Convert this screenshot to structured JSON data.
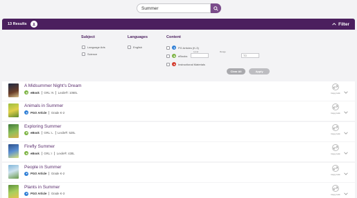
{
  "search": {
    "value": "Summer"
  },
  "results_bar": {
    "count_label": "13 Results",
    "filter_label": "Filter"
  },
  "filters": {
    "subject": {
      "title": "Subject",
      "options": [
        "Language Arts",
        "Science"
      ]
    },
    "languages": {
      "title": "Languages",
      "options": [
        "English"
      ]
    },
    "content": {
      "title": "Content",
      "options": [
        "PG Articles (K-3)",
        "eBooks",
        "Instructional Materials"
      ],
      "range_label_left": "Level",
      "range_label_right": "Range",
      "range_from": "",
      "range_to": "TO"
    },
    "clear_all": "Clear All",
    "apply": "Apply"
  },
  "results": [
    {
      "title": "A Midsummer Night's Dream",
      "type": "eBook",
      "meta1": "GRL: N",
      "meta2": "Lexile®: 1060L",
      "copy": "Copy Link"
    },
    {
      "title": "Animals in Summer",
      "type": "PGO Article",
      "meta1": "Grade K-2",
      "meta2": "",
      "copy": "Copy Link"
    },
    {
      "title": "Exploring Summer",
      "type": "eBook",
      "meta1": "GRL: L",
      "meta2": "Lexile®: 520L",
      "copy": "Copy Link"
    },
    {
      "title": "Firefly Summer",
      "type": "eBook",
      "meta1": "GRL: I",
      "meta2": "Lexile®: 430L",
      "copy": "Copy Link"
    },
    {
      "title": "People in Summer",
      "type": "PGO Article",
      "meta1": "Grade K-2",
      "meta2": "",
      "copy": "Copy Link"
    },
    {
      "title": "Plants in Summer",
      "type": "PGO Article",
      "meta1": "Grade K-3",
      "meta2": "",
      "copy": "Copy Link"
    }
  ],
  "colors": {
    "brand_purple": "#4b1f5e",
    "ebook_green": "#7cb342",
    "pgo_blue": "#2f7fd6",
    "im_red": "#d33a2c"
  }
}
